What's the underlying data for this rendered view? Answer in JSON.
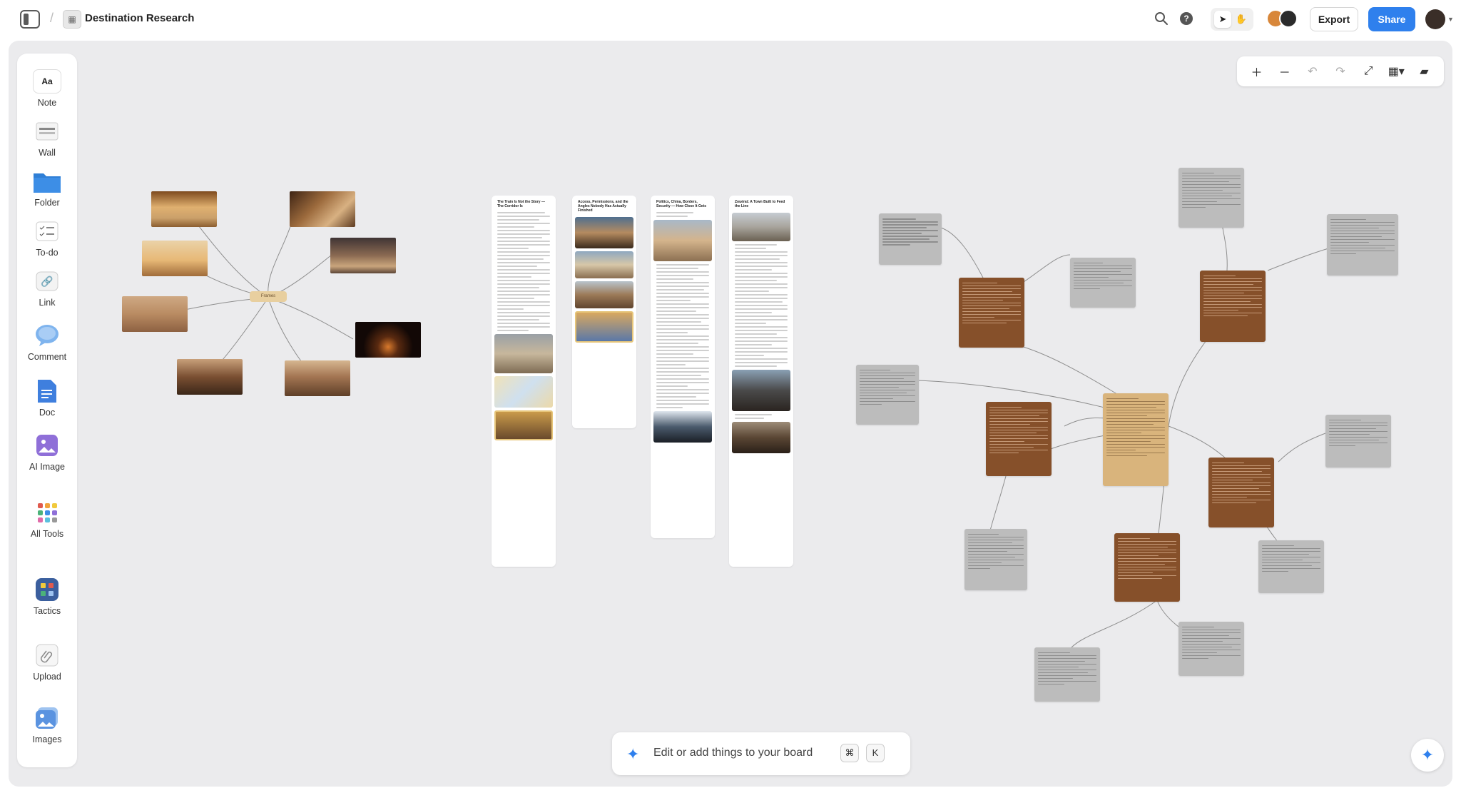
{
  "header": {
    "board_title": "Destination Research",
    "export_label": "Export",
    "share_label": "Share",
    "help_label": "?"
  },
  "toolrail": {
    "items": [
      {
        "label": "Note",
        "icon": "note-icon"
      },
      {
        "label": "Wall",
        "icon": "wall-icon"
      },
      {
        "label": "Folder",
        "icon": "folder-icon"
      },
      {
        "label": "To-do",
        "icon": "todo-icon"
      },
      {
        "label": "Link",
        "icon": "link-icon"
      },
      {
        "label": "Comment",
        "icon": "comment-icon"
      },
      {
        "label": "Doc",
        "icon": "doc-icon"
      },
      {
        "label": "AI Image",
        "icon": "ai-image-icon"
      },
      {
        "label": "All Tools",
        "icon": "all-tools-icon"
      },
      {
        "label": "Tactics",
        "icon": "tactics-icon"
      },
      {
        "label": "Upload",
        "icon": "upload-icon"
      },
      {
        "label": "Images",
        "icon": "images-icon"
      }
    ],
    "note_glyph": "Aa"
  },
  "prompt": {
    "placeholder": "Edit or add things to your board",
    "key_cmd": "⌘",
    "key_k": "K"
  },
  "mindmap": {
    "center_label": "Frames"
  },
  "cards": [
    {
      "title": "The Train Is Not the Story — The Corridor Is"
    },
    {
      "title": "Access, Permissions, and the Angles Nobody Has Actually Finished"
    },
    {
      "title": "Politics, China, Borders, Security — How Close It Gets"
    },
    {
      "title": "Zouérat: A Town Built to Feed the Line"
    }
  ],
  "colors": {
    "accent": "#2f80ed",
    "canvas_bg": "#ebebed",
    "note_grey": "#bcbcbc",
    "note_brown": "#86502a",
    "note_tan": "#d9b47c",
    "frames_pill": "#e8cf9f"
  }
}
